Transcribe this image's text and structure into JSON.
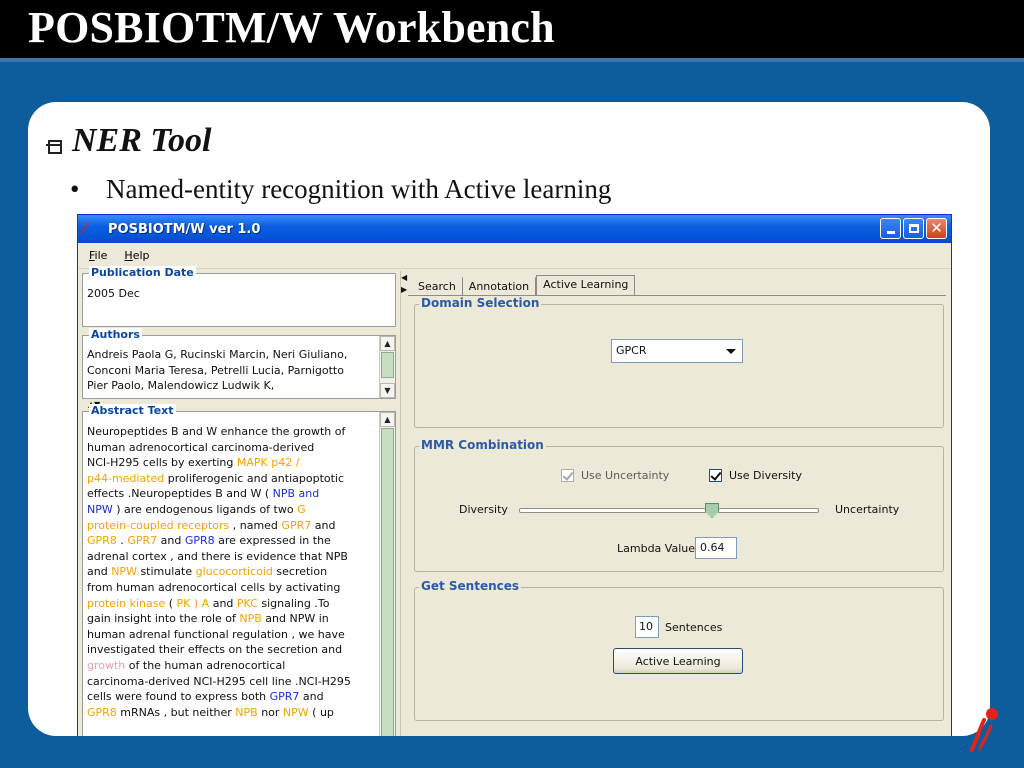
{
  "slide": {
    "title": "POSBIOTM/W Workbench",
    "bullet_title": "NER Tool",
    "sub_bullet": "Named-entity recognition with Active learning",
    "colors": {
      "background": "#0d5c9c",
      "title_bar": "#000000",
      "panel": "#ffffff"
    }
  },
  "window": {
    "title": "POSBIOTM/W ver 1.0",
    "icon": "posbiotm-app-icon",
    "buttons": {
      "minimize": "minimize-icon",
      "maximize": "maximize-icon",
      "close": "close-icon"
    }
  },
  "menu": {
    "file": "File",
    "help": "Help"
  },
  "left": {
    "publication_date_label": "Publication Date",
    "publication_date_value": "2005 Dec",
    "authors_label": "Authors",
    "authors_lines": [
      "Andreis Paola G, Rucinski Marcin, Neri Giuliano,",
      "Conconi Maria Teresa, Petrelli Lucia, Parnigotto",
      "Pier Paolo, Malendowicz Ludwik K,"
    ],
    "abstract_label": "Abstract Text",
    "abstract_lines": [
      [
        {
          "t": "Neuropeptides B and W enhance the growth of",
          "c": ""
        }
      ],
      [
        {
          "t": "human adrenocortical carcinoma-derived",
          "c": ""
        }
      ],
      [
        {
          "t": "NCI-H295 cells by exerting ",
          "c": ""
        },
        {
          "t": "MAPK p42 /",
          "c": "o"
        }
      ],
      [
        {
          "t": "p44-mediated",
          "c": "o"
        },
        {
          "t": " proliferogenic and antiapoptotic",
          "c": ""
        }
      ],
      [
        {
          "t": "effects .Neuropeptides B and W ( ",
          "c": ""
        },
        {
          "t": "NPB and",
          "c": "b"
        }
      ],
      [
        {
          "t": "NPW",
          "c": "b"
        },
        {
          "t": " ) are endogenous ligands of two ",
          "c": ""
        },
        {
          "t": "G",
          "c": "o"
        }
      ],
      [
        {
          "t": "protein-coupled receptors",
          "c": "o"
        },
        {
          "t": " , named ",
          "c": ""
        },
        {
          "t": "GPR7",
          "c": "o"
        },
        {
          "t": " and",
          "c": ""
        }
      ],
      [
        {
          "t": "GPR8",
          "c": "o"
        },
        {
          "t": " . ",
          "c": ""
        },
        {
          "t": "GPR7",
          "c": "o"
        },
        {
          "t": " and ",
          "c": ""
        },
        {
          "t": "GPR8",
          "c": "b"
        },
        {
          "t": " are expressed in the",
          "c": ""
        }
      ],
      [
        {
          "t": "adrenal cortex , and there is evidence that NPB",
          "c": ""
        }
      ],
      [
        {
          "t": "and ",
          "c": ""
        },
        {
          "t": "NPW",
          "c": "o"
        },
        {
          "t": " stimulate ",
          "c": ""
        },
        {
          "t": "glucocorticoid",
          "c": "o"
        },
        {
          "t": " secretion",
          "c": ""
        }
      ],
      [
        {
          "t": "from human adrenocortical cells by activating",
          "c": ""
        }
      ],
      [
        {
          "t": "protein kinase",
          "c": "o"
        },
        {
          "t": " ( ",
          "c": ""
        },
        {
          "t": "PK ) A",
          "c": "o"
        },
        {
          "t": " and ",
          "c": ""
        },
        {
          "t": "PKC",
          "c": "o"
        },
        {
          "t": " signaling .To",
          "c": ""
        }
      ],
      [
        {
          "t": "gain insight into the role of ",
          "c": ""
        },
        {
          "t": "NPB",
          "c": "o"
        },
        {
          "t": " and NPW in",
          "c": ""
        }
      ],
      [
        {
          "t": "human adrenal functional regulation , we have",
          "c": ""
        }
      ],
      [
        {
          "t": "investigated their effects on the secretion and",
          "c": ""
        }
      ],
      [
        {
          "t": "growth",
          "c": "p"
        },
        {
          "t": " of the human adrenocortical",
          "c": ""
        }
      ],
      [
        {
          "t": "carcinoma-derived NCI-H295 cell line .NCI-H295",
          "c": ""
        }
      ],
      [
        {
          "t": "cells were found to express both ",
          "c": ""
        },
        {
          "t": "GPR7",
          "c": "b"
        },
        {
          "t": " and",
          "c": ""
        }
      ],
      [
        {
          "t": "GPR8",
          "c": "o"
        },
        {
          "t": " mRNAs , but neither ",
          "c": ""
        },
        {
          "t": "NPB",
          "c": "o"
        },
        {
          "t": " nor ",
          "c": ""
        },
        {
          "t": "NPW",
          "c": "o"
        },
        {
          "t": " ( up",
          "c": ""
        }
      ]
    ],
    "highlight_colors": {
      "o": "#f5a300",
      "b": "#1b2fd6",
      "p": "#f0a0a8"
    }
  },
  "tabs": [
    {
      "label": "Search",
      "active": false
    },
    {
      "label": "Annotation",
      "active": false
    },
    {
      "label": "Active Learning",
      "active": true
    }
  ],
  "domain_selection": {
    "label": "Domain Selection",
    "selected": "GPCR"
  },
  "mmr": {
    "label": "MMR Combination",
    "use_uncertainty": {
      "label": "Use Uncertainty",
      "checked": true,
      "enabled": false
    },
    "use_diversity": {
      "label": "Use Diversity",
      "checked": true,
      "enabled": true
    },
    "slider_left": "Diversity",
    "slider_right": "Uncertainty",
    "slider_value": 0.64,
    "lambda_label": "Lambda Value",
    "lambda_value": "0.64"
  },
  "get_sentences": {
    "label": "Get Sentences",
    "count": "10",
    "count_label": "Sentences",
    "button": "Active Learning"
  }
}
